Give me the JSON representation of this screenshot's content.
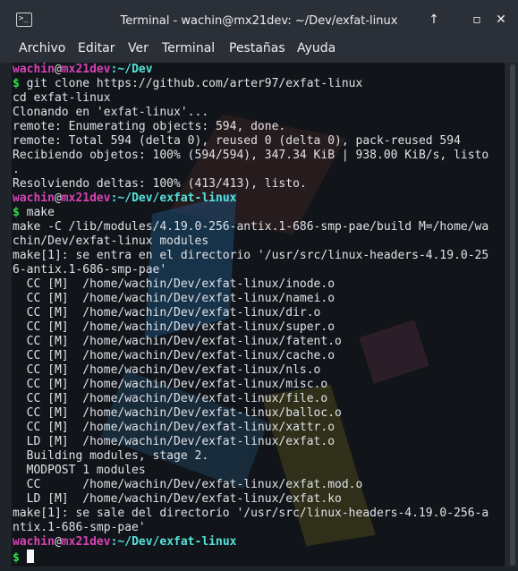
{
  "window": {
    "title": "Terminal - wachin@mx21dev: ~/Dev/exfat-linux",
    "app_icon": ">_",
    "button_up": "↑",
    "button_min": "▫",
    "button_close": "✕"
  },
  "menu": [
    "Archivo",
    "Editar",
    "Ver",
    "Terminal",
    "Pestañas",
    "Ayuda"
  ],
  "terminal": {
    "lines": [
      {
        "kind": "promptinfo",
        "user": "wachin",
        "at": "@",
        "host": "mx21dev",
        "path": ":~/Dev"
      },
      {
        "kind": "command",
        "prompt": "$",
        "text": " git clone https://github.com/arter97/exfat-linux"
      },
      {
        "kind": "text",
        "text": "cd exfat-linux"
      },
      {
        "kind": "text",
        "text": "Clonando en 'exfat-linux'..."
      },
      {
        "kind": "text",
        "text": "remote: Enumerating objects: 594, done."
      },
      {
        "kind": "text",
        "text": "remote: Total 594 (delta 0), reused 0 (delta 0), pack-reused 594"
      },
      {
        "kind": "text",
        "text": "Recibiendo objetos: 100% (594/594), 347.34 KiB | 938.00 KiB/s, listo"
      },
      {
        "kind": "text",
        "text": "."
      },
      {
        "kind": "text",
        "text": "Resolviendo deltas: 100% (413/413), listo."
      },
      {
        "kind": "promptinfo",
        "user": "wachin",
        "at": "@",
        "host": "mx21dev",
        "path": ":~/Dev/exfat-linux"
      },
      {
        "kind": "command",
        "prompt": "$",
        "text": " make"
      },
      {
        "kind": "text",
        "text": "make -C /lib/modules/4.19.0-256-antix.1-686-smp-pae/build M=/home/wa"
      },
      {
        "kind": "text",
        "text": "chin/Dev/exfat-linux modules"
      },
      {
        "kind": "text",
        "text": "make[1]: se entra en el directorio '/usr/src/linux-headers-4.19.0-25"
      },
      {
        "kind": "text",
        "text": "6-antix.1-686-smp-pae'"
      },
      {
        "kind": "text",
        "text": "  CC [M]  /home/wachin/Dev/exfat-linux/inode.o"
      },
      {
        "kind": "text",
        "text": "  CC [M]  /home/wachin/Dev/exfat-linux/namei.o"
      },
      {
        "kind": "text",
        "text": "  CC [M]  /home/wachin/Dev/exfat-linux/dir.o"
      },
      {
        "kind": "text",
        "text": "  CC [M]  /home/wachin/Dev/exfat-linux/super.o"
      },
      {
        "kind": "text",
        "text": "  CC [M]  /home/wachin/Dev/exfat-linux/fatent.o"
      },
      {
        "kind": "text",
        "text": "  CC [M]  /home/wachin/Dev/exfat-linux/cache.o"
      },
      {
        "kind": "text",
        "text": "  CC [M]  /home/wachin/Dev/exfat-linux/nls.o"
      },
      {
        "kind": "text",
        "text": "  CC [M]  /home/wachin/Dev/exfat-linux/misc.o"
      },
      {
        "kind": "text",
        "text": "  CC [M]  /home/wachin/Dev/exfat-linux/file.o"
      },
      {
        "kind": "text",
        "text": "  CC [M]  /home/wachin/Dev/exfat-linux/balloc.o"
      },
      {
        "kind": "text",
        "text": "  CC [M]  /home/wachin/Dev/exfat-linux/xattr.o"
      },
      {
        "kind": "text",
        "text": "  LD [M]  /home/wachin/Dev/exfat-linux/exfat.o"
      },
      {
        "kind": "text",
        "text": "  Building modules, stage 2."
      },
      {
        "kind": "text",
        "text": "  MODPOST 1 modules"
      },
      {
        "kind": "text",
        "text": "  CC      /home/wachin/Dev/exfat-linux/exfat.mod.o"
      },
      {
        "kind": "text",
        "text": "  LD [M]  /home/wachin/Dev/exfat-linux/exfat.ko"
      },
      {
        "kind": "text",
        "text": "make[1]: se sale del directorio '/usr/src/linux-headers-4.19.0-256-a"
      },
      {
        "kind": "text",
        "text": "ntix.1-686-smp-pae'"
      },
      {
        "kind": "promptinfo",
        "user": "wachin",
        "at": "@",
        "host": "mx21dev",
        "path": ":~/Dev/exfat-linux"
      },
      {
        "kind": "command",
        "prompt": "$",
        "text": " "
      }
    ]
  }
}
